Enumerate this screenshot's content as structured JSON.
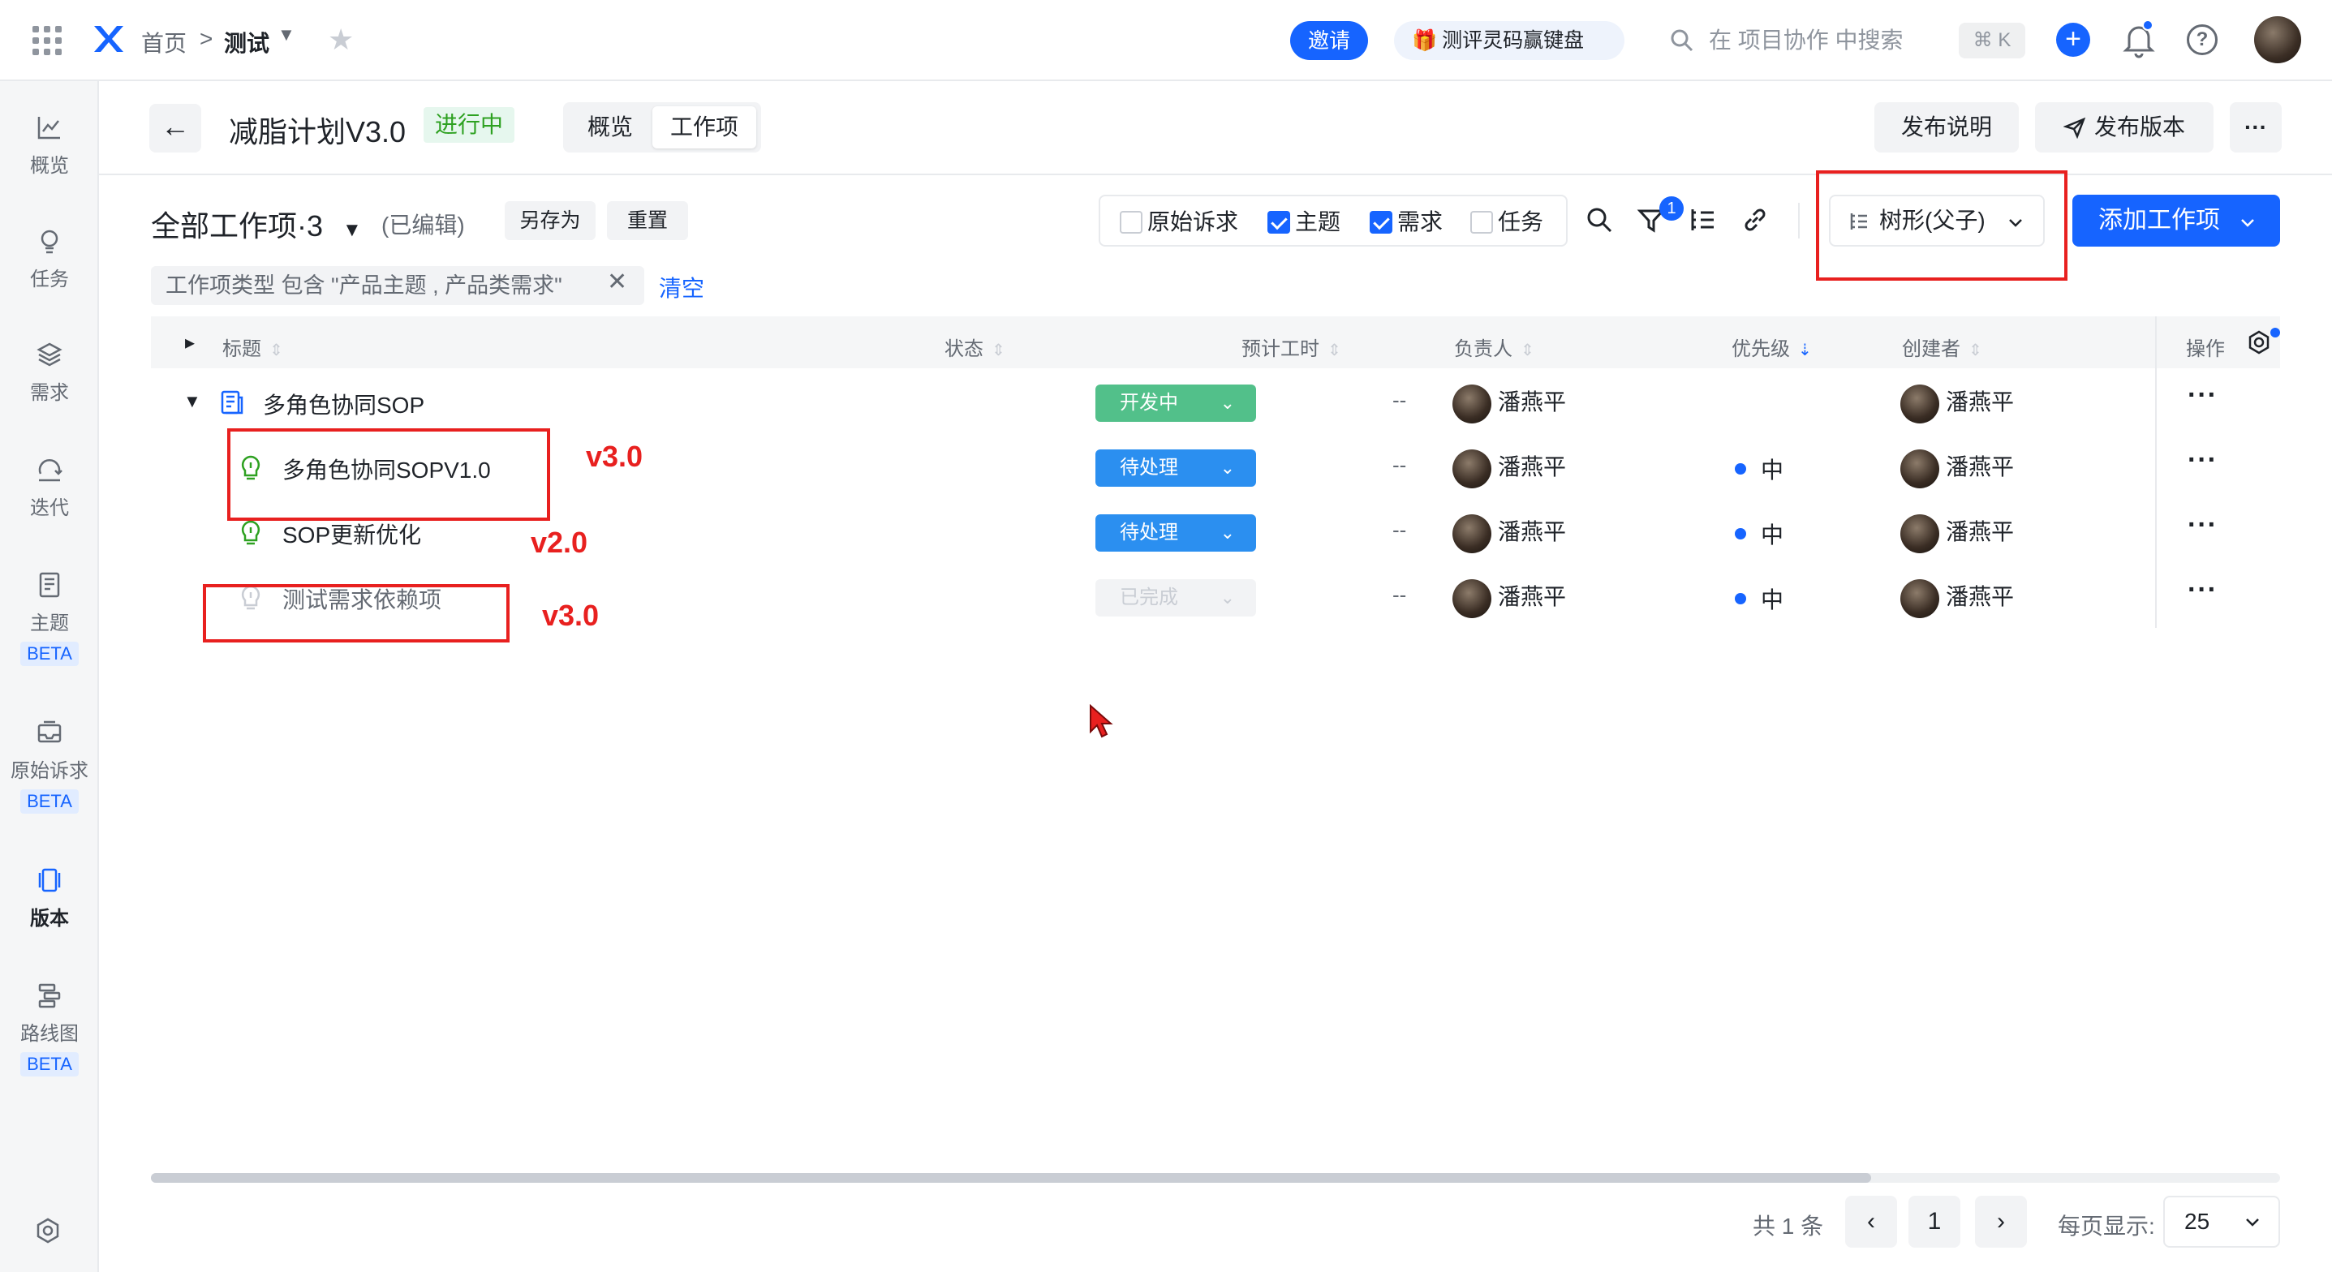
{
  "topbar": {
    "breadcrumb_home": "首页",
    "breadcrumb_sep": ">",
    "project_name": "测试",
    "invite_label": "邀请",
    "promo_label": "测评灵码赢键盘",
    "search_placeholder": "在 项目协作 中搜索",
    "shortcut": "⌘ K"
  },
  "sidebar": {
    "items": [
      {
        "label": "概览",
        "icon": "chart-line-icon"
      },
      {
        "label": "任务",
        "icon": "bulb-icon"
      },
      {
        "label": "需求",
        "icon": "layers-icon"
      },
      {
        "label": "迭代",
        "icon": "iteration-icon"
      },
      {
        "label": "主题",
        "icon": "document-icon",
        "badge": "BETA"
      },
      {
        "label": "原始诉求",
        "icon": "inbox-icon",
        "badge": "BETA"
      },
      {
        "label": "版本",
        "icon": "version-icon",
        "active": true
      },
      {
        "label": "路线图",
        "icon": "roadmap-icon",
        "badge": "BETA"
      }
    ]
  },
  "header": {
    "back": "←",
    "title": "减脂计划V3.0",
    "status": "进行中",
    "tabs": [
      "概览",
      "工作项"
    ],
    "active_tab": "工作项",
    "release_notes": "发布说明",
    "publish": "发布版本",
    "more": "···"
  },
  "toolbar": {
    "view_title": "全部工作项·3",
    "edited": "(已编辑)",
    "save_as": "另存为",
    "reset": "重置",
    "type_filters": [
      {
        "label": "原始诉求",
        "checked": false
      },
      {
        "label": "主题",
        "checked": true
      },
      {
        "label": "需求",
        "checked": true
      },
      {
        "label": "任务",
        "checked": false
      }
    ],
    "filter_badge": "1",
    "view_mode": "树形(父子)",
    "add_item": "添加工作项",
    "filter_chip": "工作项类型 包含 \"产品主题 , 产品类需求\"",
    "clear": "清空"
  },
  "table": {
    "columns": [
      "标题",
      "状态",
      "预计工时",
      "负责人",
      "优先级",
      "创建者",
      "操作"
    ],
    "rows": [
      {
        "title": "多角色协同SOP",
        "status": "开发中",
        "hours": "--",
        "owner": "潘燕平",
        "priority": "",
        "creator": "潘燕平",
        "more": "···"
      },
      {
        "title": "多角色协同SOPV1.0",
        "status": "待处理",
        "hours": "--",
        "owner": "潘燕平",
        "priority": "中",
        "creator": "潘燕平",
        "more": "···"
      },
      {
        "title": "SOP更新优化",
        "status": "待处理",
        "hours": "--",
        "owner": "潘燕平",
        "priority": "中",
        "creator": "潘燕平",
        "more": "···"
      },
      {
        "title": "测试需求依赖项",
        "status": "已完成",
        "hours": "--",
        "owner": "潘燕平",
        "priority": "中",
        "creator": "潘燕平",
        "more": "···"
      }
    ]
  },
  "annotations": [
    "v3.0",
    "v2.0",
    "v3.0"
  ],
  "pagination": {
    "total": "共 1 条",
    "prev": "‹",
    "page": "1",
    "next": "›",
    "per_page_label": "每页显示:",
    "per_page": "25"
  },
  "colors": {
    "accent": "#1664ff",
    "status_dev": "#52c08a",
    "status_pending": "#2b8ff0",
    "annotation_red": "#e8201f"
  }
}
